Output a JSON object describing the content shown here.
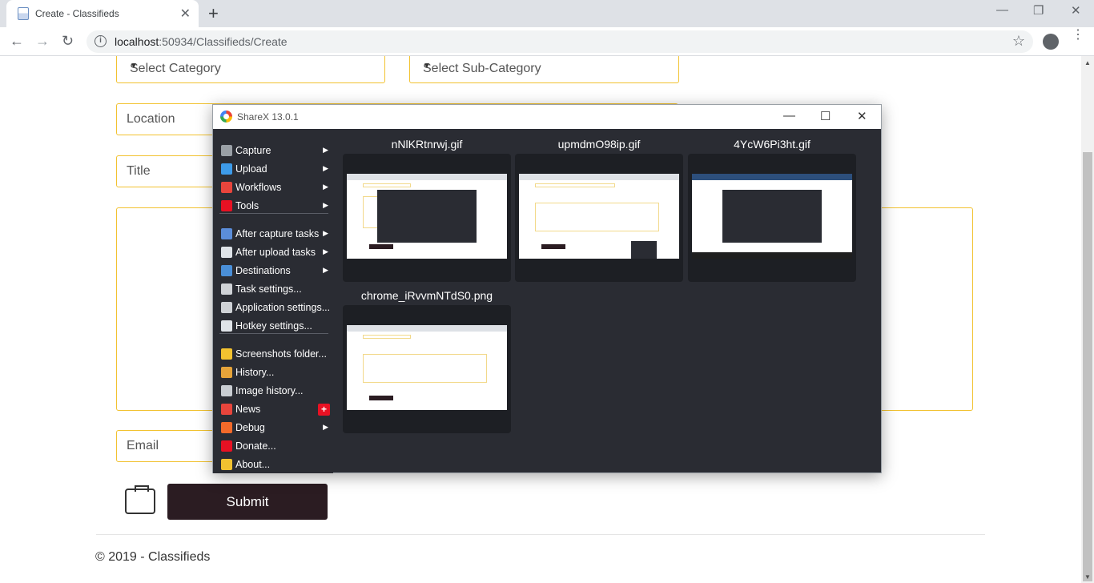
{
  "browser": {
    "tab_title": "Create - Classifieds",
    "new_tab": "+",
    "tab_close": "✕",
    "url_host": "localhost",
    "url_rest": ":50934/Classifieds/Create",
    "back": "←",
    "forward": "→",
    "reload": "↻",
    "star": "☆",
    "info": "i",
    "minimize": "—",
    "restore": "❐",
    "close": "✕",
    "menu": "⋮"
  },
  "form": {
    "category_placeholder": "Select Category",
    "subcategory_placeholder": "Select Sub-Category",
    "location_placeholder": "Location",
    "title_placeholder": "Title",
    "email_placeholder": "Email",
    "caret": "▼",
    "submit_label": "Submit",
    "footer": "© 2019 - Classifieds"
  },
  "sharex": {
    "title": "ShareX 13.0.1",
    "minimize": "—",
    "maximize": "☐",
    "close": "✕",
    "menu_arrow": "▶",
    "menu": [
      {
        "label": "Capture",
        "icon": "capture-icon",
        "color": "#9aa0a6",
        "arrow": true
      },
      {
        "label": "Upload",
        "icon": "upload-arrow-icon",
        "color": "#3d9be9",
        "arrow": true
      },
      {
        "label": "Workflows",
        "icon": "workflows-grid-icon",
        "color": "#e8453c",
        "arrow": true
      },
      {
        "label": "Tools",
        "icon": "tools-icon",
        "color": "#e81123",
        "arrow": true
      },
      {
        "label": "After capture tasks",
        "icon": "after-capture-icon",
        "color": "#5b8dd9",
        "arrow": true
      },
      {
        "label": "After upload tasks",
        "icon": "after-upload-cloud-icon",
        "color": "#dfe3e8",
        "arrow": true
      },
      {
        "label": "Destinations",
        "icon": "destinations-icon",
        "color": "#4a8fd8",
        "arrow": true
      },
      {
        "label": "Task settings...",
        "icon": "gear-icon",
        "color": "#cfd2d6",
        "arrow": false
      },
      {
        "label": "Application settings...",
        "icon": "wrench-icon",
        "color": "#cfd2d6",
        "arrow": false
      },
      {
        "label": "Hotkey settings...",
        "icon": "keyboard-key-icon",
        "color": "#dfe3e8",
        "arrow": false
      },
      {
        "label": "Screenshots folder...",
        "icon": "folder-icon",
        "color": "#f2c230",
        "arrow": false
      },
      {
        "label": "History...",
        "icon": "history-icon",
        "color": "#e6a43a",
        "arrow": false
      },
      {
        "label": "Image history...",
        "icon": "image-history-icon",
        "color": "#c9cdd2",
        "arrow": false
      },
      {
        "label": "News",
        "icon": "megaphone-icon",
        "color": "#e8453c",
        "arrow": false,
        "badge": "+"
      },
      {
        "label": "Debug",
        "icon": "traffic-cone-icon",
        "color": "#f36a2a",
        "arrow": true
      },
      {
        "label": "Donate...",
        "icon": "heart-icon",
        "color": "#e81123",
        "arrow": false
      },
      {
        "label": "About...",
        "icon": "crown-icon",
        "color": "#f2c230",
        "arrow": false
      }
    ],
    "thumbnails": [
      {
        "name": "nNlKRtnrwj.gif"
      },
      {
        "name": "upmdmO98ip.gif"
      },
      {
        "name": "4YcW6Pi3ht.gif"
      },
      {
        "name": "chrome_iRvvmNTdS0.png"
      }
    ]
  }
}
